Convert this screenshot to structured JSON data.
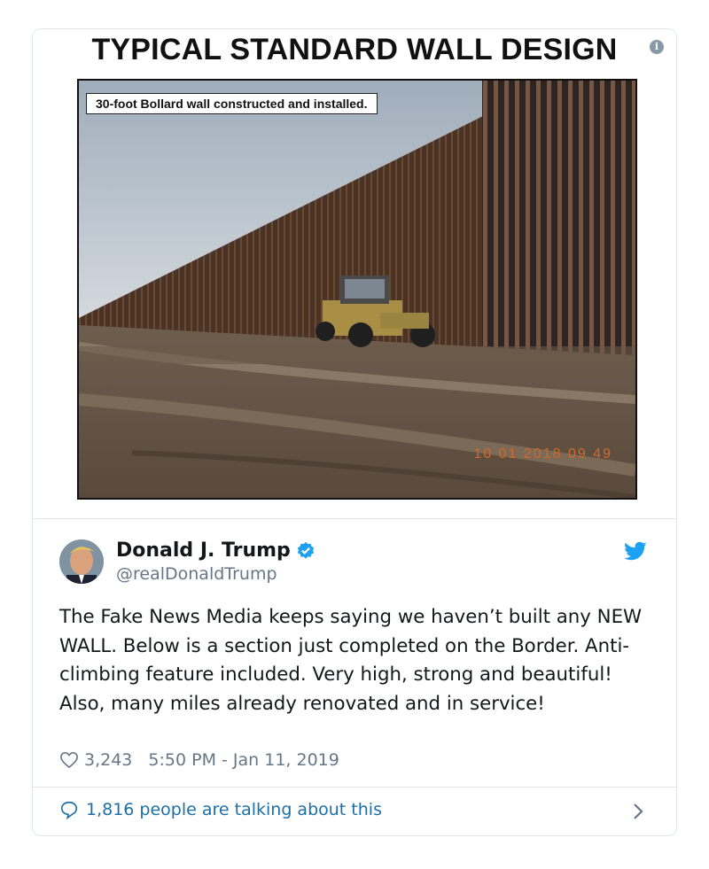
{
  "media": {
    "title": "TYPICAL STANDARD WALL DESIGN",
    "caption": "30-foot Bollard wall constructed and installed.",
    "timestamp": "10 01 2018 09 49"
  },
  "tweet": {
    "author_name": "Donald J. Trump",
    "handle": "@realDonaldTrump",
    "text": "The Fake News Media keeps saying we haven’t built any NEW WALL. Below is a section just completed on the Border. Anti-climbing feature included. Very high, strong and beautiful! Also, many miles already renovated and in service!",
    "likes": "3,243",
    "time": "5:50 PM - Jan 11, 2019",
    "talking": "1,816 people are talking about this"
  },
  "colors": {
    "link_blue": "#1b6fa8",
    "verified_blue": "#1da1f2",
    "muted_gray": "#657786"
  },
  "icons": [
    "info-icon",
    "verified-icon",
    "twitter-bird-icon",
    "heart-icon",
    "speech-bubble-icon",
    "chevron-right-icon"
  ]
}
